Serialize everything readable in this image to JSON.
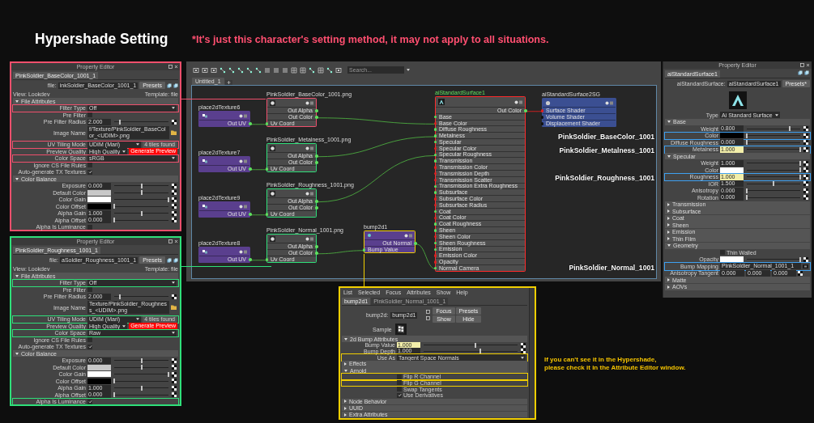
{
  "title": "Hypershade Setting",
  "note": "*It's just this character's setting method, it may not apply to all situations.",
  "property_editors": [
    {
      "color": "#ef4f6c",
      "window_title": "Property Editor",
      "tab": "PinkSoldier_BaseColor_1001_1",
      "name_label": "file:",
      "name_value": "inkSoldier_BaseColor_1001_1",
      "presets": "Presets",
      "view": "View: Lookdev",
      "template": "Template: file",
      "sections": [
        {
          "title": "File Attributes",
          "expanded": true,
          "rows": [
            {
              "label": "Filter Type",
              "kind": "dropdown",
              "value": "Off",
              "highlighted": true
            },
            {
              "label": "Pre Filter",
              "kind": "checkbox",
              "checked": false,
              "highlighted": false
            },
            {
              "label": "Pre Filter Radius",
              "kind": "slider",
              "value": "2.000",
              "level": 0.1,
              "connected": false,
              "highlighted": false
            },
            {
              "label": "Image Name",
              "kind": "file",
              "value": "f/Texture/PinkSoldier_BaseColor_<UDIM>.png",
              "highlighted": false
            },
            {
              "label": "UV Tiling Mode",
              "kind": "dropdown",
              "value": "UDIM (Mari)",
              "extra": "4 tiles found",
              "highlighted": true
            },
            {
              "label": "Preview Quality",
              "kind": "dropdown",
              "value": "High Quality",
              "button": "Generate Preview",
              "highlighted": false
            },
            {
              "label": "Color Space",
              "kind": "dropdown",
              "value": "sRGB",
              "highlighted": true
            },
            {
              "label": "Ignore CS File Rules",
              "kind": "checkbox",
              "checked": false,
              "highlighted": false
            },
            {
              "label": "Auto-generate TX Textures",
              "kind": "checkbox",
              "checked": true,
              "highlighted": false
            }
          ]
        },
        {
          "title": "Color Balance",
          "expanded": true,
          "rows": [
            {
              "label": "Exposure",
              "kind": "slider",
              "value": "0.000",
              "level": 0.5,
              "connected": false,
              "highlighted": false
            },
            {
              "label": "Default Color",
              "kind": "swatch",
              "color": "#c8c8c8",
              "level": 0.5,
              "highlighted": false
            },
            {
              "label": "Color Gain",
              "kind": "swatch",
              "color": "#ffffff",
              "level": 1,
              "highlighted": false
            },
            {
              "label": "Color Offset",
              "kind": "swatch",
              "color": "#000000",
              "level": 0,
              "highlighted": false
            },
            {
              "label": "Alpha Gain",
              "kind": "slider",
              "value": "1.000",
              "level": 0.5,
              "connected": false,
              "highlighted": false
            },
            {
              "label": "Alpha Offset",
              "kind": "slider",
              "value": "0.000",
              "level": 0,
              "connected": false,
              "highlighted": false
            },
            {
              "label": "Alpha Is Luminance",
              "kind": "checkbox",
              "checked": false,
              "highlighted": false
            }
          ]
        }
      ]
    },
    {
      "color": "#2fe07a",
      "window_title": "Property Editor",
      "tab": "PinkSoldier_Roughness_1001_1",
      "name_label": "file:",
      "name_value": "aSoldier_Roughness_1001_1",
      "presets": "Presets",
      "view": "View: Lookdev",
      "template": "Template: file",
      "sections": [
        {
          "title": "File Attributes",
          "expanded": true,
          "rows": [
            {
              "label": "Filter Type",
              "kind": "dropdown",
              "value": "Off",
              "highlighted": true
            },
            {
              "label": "Pre Filter",
              "kind": "checkbox",
              "checked": false,
              "highlighted": false
            },
            {
              "label": "Pre Filter Radius",
              "kind": "slider",
              "value": "2.000",
              "level": 0.1,
              "connected": false,
              "highlighted": false
            },
            {
              "label": "Image Name",
              "kind": "file",
              "value": "Texture/PinkSoldier_Roughness_<UDIM>.png",
              "highlighted": false
            },
            {
              "label": "UV Tiling Mode",
              "kind": "dropdown",
              "value": "UDIM (Mari)",
              "extra": "4 tiles found",
              "highlighted": true
            },
            {
              "label": "Preview Quality",
              "kind": "dropdown",
              "value": "High Quality",
              "button": "Generate Preview",
              "highlighted": false
            },
            {
              "label": "Color Space",
              "kind": "dropdown",
              "value": "Raw",
              "highlighted": true
            },
            {
              "label": "Ignore CS File Rules",
              "kind": "checkbox",
              "checked": false,
              "highlighted": false
            },
            {
              "label": "Auto-generate TX Textures",
              "kind": "checkbox",
              "checked": true,
              "highlighted": false
            }
          ]
        },
        {
          "title": "Color Balance",
          "expanded": true,
          "rows": [
            {
              "label": "Exposure",
              "kind": "slider",
              "value": "0.000",
              "level": 0.5,
              "connected": false,
              "highlighted": false
            },
            {
              "label": "Default Color",
              "kind": "swatch",
              "color": "#c8c8c8",
              "level": 0.5,
              "highlighted": false
            },
            {
              "label": "Color Gain",
              "kind": "swatch",
              "color": "#ffffff",
              "level": 1,
              "highlighted": false
            },
            {
              "label": "Color Offset",
              "kind": "swatch",
              "color": "#000000",
              "level": 0,
              "highlighted": false
            },
            {
              "label": "Alpha Gain",
              "kind": "slider",
              "value": "1.000",
              "level": 0.5,
              "connected": false,
              "highlighted": false
            },
            {
              "label": "Alpha Offset",
              "kind": "slider",
              "value": "0.000",
              "level": 0,
              "connected": false,
              "highlighted": false
            },
            {
              "label": "Alpha Is Luminance",
              "kind": "checkbox",
              "checked": true,
              "highlighted": true
            }
          ]
        }
      ]
    }
  ],
  "hypershade": {
    "search": {
      "placeholder": "Search..."
    },
    "tab": "Untitled_1",
    "nodes": [
      {
        "kind": "place2d",
        "title": "place2dTexture6",
        "ports": [
          {
            "label": "Out UV",
            "kind": "out"
          }
        ]
      },
      {
        "kind": "file",
        "title": "PinkSoldier_BaseColor_1001.png",
        "color": "#ef4f6c",
        "ports": [
          {
            "label": "Out Alpha",
            "kind": "out"
          },
          {
            "label": "Out Color",
            "kind": "out"
          },
          {
            "label": "Uv Coord",
            "kind": "in"
          }
        ]
      },
      {
        "kind": "place2d",
        "title": "place2dTexture7",
        "ports": [
          {
            "label": "Out UV",
            "kind": "out"
          }
        ]
      },
      {
        "kind": "file",
        "title": "PinkSoldier_Metalness_1001.png",
        "color": "#2fe07a",
        "ports": [
          {
            "label": "Out Alpha",
            "kind": "out"
          },
          {
            "label": "Out Color",
            "kind": "out"
          },
          {
            "label": "Uv Coord",
            "kind": "in"
          }
        ]
      },
      {
        "kind": "place2d",
        "title": "place2dTexture9",
        "ports": [
          {
            "label": "Out UV",
            "kind": "out"
          }
        ]
      },
      {
        "kind": "file",
        "title": "PinkSoldier_Roughness_1001.png",
        "color": "#2fe07a",
        "ports": [
          {
            "label": "Out Alpha",
            "kind": "out"
          },
          {
            "label": "Out Color",
            "kind": "out"
          },
          {
            "label": "Uv Coord",
            "kind": "in"
          }
        ]
      },
      {
        "kind": "place2d",
        "title": "place2dTexture8",
        "ports": [
          {
            "label": "Out UV",
            "kind": "out"
          }
        ]
      },
      {
        "kind": "file",
        "title": "PinkSoldier_Normal_1001.png",
        "color": "#2fe07a",
        "ports": [
          {
            "label": "Out Alpha",
            "kind": "out"
          },
          {
            "label": "Out Color",
            "kind": "out"
          },
          {
            "label": "Uv Coord",
            "kind": "in"
          }
        ]
      },
      {
        "kind": "bump",
        "title": "bump2d1",
        "color": "#f2cf00",
        "ports": [
          {
            "label": "Out Normal",
            "kind": "out"
          },
          {
            "label": "Bump Value",
            "kind": "in"
          }
        ]
      },
      {
        "kind": "shader",
        "title": "aiStandardSurface1",
        "color": "#ff2a2a",
        "ports": [
          {
            "label": "Out Color",
            "kind": "out"
          },
          {
            "label": "Base",
            "kind": "in"
          },
          {
            "label": "Base Color",
            "kind": "in_color"
          },
          {
            "label": "Diffuse Roughness",
            "kind": "in"
          },
          {
            "label": "Metalness",
            "kind": "in"
          },
          {
            "label": "Specular",
            "kind": "in"
          },
          {
            "label": "Specular Color",
            "kind": "in_color"
          },
          {
            "label": "Specular Roughness",
            "kind": "in"
          },
          {
            "label": "Transmission",
            "kind": "in"
          },
          {
            "label": "Transmission Color",
            "kind": "in_color"
          },
          {
            "label": "Transmission Depth",
            "kind": "in_color"
          },
          {
            "label": "Transmission Scatter",
            "kind": "in_color"
          },
          {
            "label": "Transmission Extra Roughness",
            "kind": "in"
          },
          {
            "label": "Subsurface",
            "kind": "in"
          },
          {
            "label": "Subsurface Color",
            "kind": "in_color"
          },
          {
            "label": "Subsurface Radius",
            "kind": "in_color"
          },
          {
            "label": "Coat",
            "kind": "in"
          },
          {
            "label": "Coat Color",
            "kind": "in_color"
          },
          {
            "label": "Coat Roughness",
            "kind": "in"
          },
          {
            "label": "Sheen",
            "kind": "in"
          },
          {
            "label": "Sheen Color",
            "kind": "in_color"
          },
          {
            "label": "Sheen Roughness",
            "kind": "in"
          },
          {
            "label": "Emission",
            "kind": "in"
          },
          {
            "label": "Emission Color",
            "kind": "in_color"
          },
          {
            "label": "Opacity",
            "kind": "in_color"
          },
          {
            "label": "Normal Camera",
            "kind": "in"
          }
        ]
      },
      {
        "kind": "sg",
        "title": "aiStandardSurface2SG",
        "ports": [
          {
            "label": "Surface Shader",
            "kind": "in_color"
          },
          {
            "label": "Volume Shader",
            "kind": "in_empty"
          },
          {
            "label": "Displacement Shader",
            "kind": "in_empty"
          }
        ]
      }
    ]
  },
  "attribute_panel": {
    "window_title": "Property Editor",
    "tab": "aiStandardSurface1",
    "name_label": "aiStandardSurface:",
    "name_value": "aiStandardSurface1",
    "presets": "Presets*",
    "type_label": "Type",
    "type_value": "Ai Standard Surface",
    "sections": [
      {
        "title": "Base",
        "expanded": true,
        "rows": [
          {
            "label": "Weight",
            "kind": "slider",
            "value": "0.800",
            "level": 0.8,
            "connected": false,
            "highlighted": false
          },
          {
            "label": "Color",
            "kind": "swatch",
            "color": "#000000",
            "level": 0,
            "highlighted": true
          },
          {
            "label": "Diffuse Roughness",
            "kind": "slider",
            "value": "0.000",
            "level": 0,
            "connected": false,
            "highlighted": false
          },
          {
            "label": "Metalness",
            "kind": "slider",
            "value": "1.000",
            "level": 1,
            "connected": true,
            "highlighted": true
          }
        ]
      },
      {
        "title": "Specular",
        "expanded": true,
        "rows": [
          {
            "label": "Weight",
            "kind": "slider",
            "value": "1.000",
            "level": 1,
            "connected": false,
            "highlighted": false
          },
          {
            "label": "Color",
            "kind": "swatch",
            "color": "#ffffff",
            "level": 1,
            "highlighted": false
          },
          {
            "label": "Roughness",
            "kind": "slider",
            "value": "1.000",
            "level": 1,
            "connected": true,
            "highlighted": true
          },
          {
            "label": "IOR",
            "kind": "slider",
            "value": "1.500",
            "level": 0.5,
            "connected": false,
            "highlighted": false
          },
          {
            "label": "Anisotropy",
            "kind": "slider",
            "value": "0.000",
            "level": 0,
            "connected": false,
            "highlighted": false
          },
          {
            "label": "Rotation",
            "kind": "slider",
            "value": "0.000",
            "level": 0,
            "connected": false,
            "highlighted": false
          }
        ]
      },
      {
        "title": "Transmission",
        "expanded": false
      },
      {
        "title": "Subsurface",
        "expanded": false
      },
      {
        "title": "Coat",
        "expanded": false
      },
      {
        "title": "Sheen",
        "expanded": false
      },
      {
        "title": "Emission",
        "expanded": false
      },
      {
        "title": "Thin Film",
        "expanded": false
      },
      {
        "title": "Geometry",
        "expanded": true,
        "rows": [
          {
            "label": "Thin Walled",
            "kind": "option",
            "checked": false,
            "highlighted": false
          },
          {
            "label": "Opacity",
            "kind": "swatch",
            "color": "#ffffff",
            "level": 1,
            "highlighted": false
          },
          {
            "label": "Bump Mapping",
            "kind": "map",
            "value": "PinkSoldier_Normal_1001_1",
            "highlighted": true
          },
          {
            "label": "Anisotropy Tangent",
            "kind": "triple",
            "values": [
              "0.000",
              "0.000",
              "0.000"
            ],
            "highlighted": false
          }
        ]
      },
      {
        "title": "Matte",
        "expanded": false
      },
      {
        "title": "AOVs",
        "expanded": false
      }
    ]
  },
  "callouts": [
    "PinkSoldier_BaseColor_1001",
    "PinkSoldier_Metalness_1001",
    "PinkSoldier_Roughness_1001",
    "PinkSoldier_Normal_1001"
  ],
  "bump_editor": {
    "menu": [
      "List",
      "Selected",
      "Focus",
      "Attributes",
      "Show",
      "Help"
    ],
    "tabs": [
      {
        "label": "bump2d1",
        "selected": true
      },
      {
        "label": "PinkSoldier_Normal_1001_1",
        "selected": false
      }
    ],
    "name_label": "bump2d:",
    "name_value": "bump2d1",
    "buttons": [
      "Focus",
      "Presets",
      "Show",
      "Hide"
    ],
    "sample_label": "Sample",
    "sections": [
      {
        "title": "2d Bump Attributes",
        "expanded": true,
        "rows": [
          {
            "label": "Bump Value",
            "kind": "slider",
            "value": "1.000",
            "level": 0.55,
            "connected": true,
            "highlighted": false
          },
          {
            "label": "Bump Depth",
            "kind": "slider",
            "value": "1.000",
            "level": 0.6,
            "connected": false,
            "highlighted": false
          },
          {
            "label": "Use As",
            "kind": "dropdown",
            "value": "Tangent Space Normals",
            "highlighted": true
          }
        ]
      },
      {
        "title": "Effects",
        "expanded": false
      },
      {
        "title": "Arnold",
        "expanded": true,
        "rows": [
          {
            "label": "Flip R Channel",
            "kind": "option",
            "checked": false,
            "highlighted": true
          },
          {
            "label": "Flip G Channel",
            "kind": "option",
            "checked": false,
            "highlighted": true
          },
          {
            "label": "Swap Tangents",
            "kind": "option",
            "checked": false,
            "highlighted": false
          },
          {
            "label": "Use Derivatives",
            "kind": "option",
            "checked": true,
            "highlighted": false
          }
        ]
      },
      {
        "title": "Node Behavior",
        "expanded": false
      },
      {
        "title": "UUID",
        "expanded": false
      },
      {
        "title": "Extra Attributes",
        "expanded": false
      }
    ]
  },
  "hint": "If you can't see it in the Hypershade,\nplease check it in the Attribute Editor window."
}
